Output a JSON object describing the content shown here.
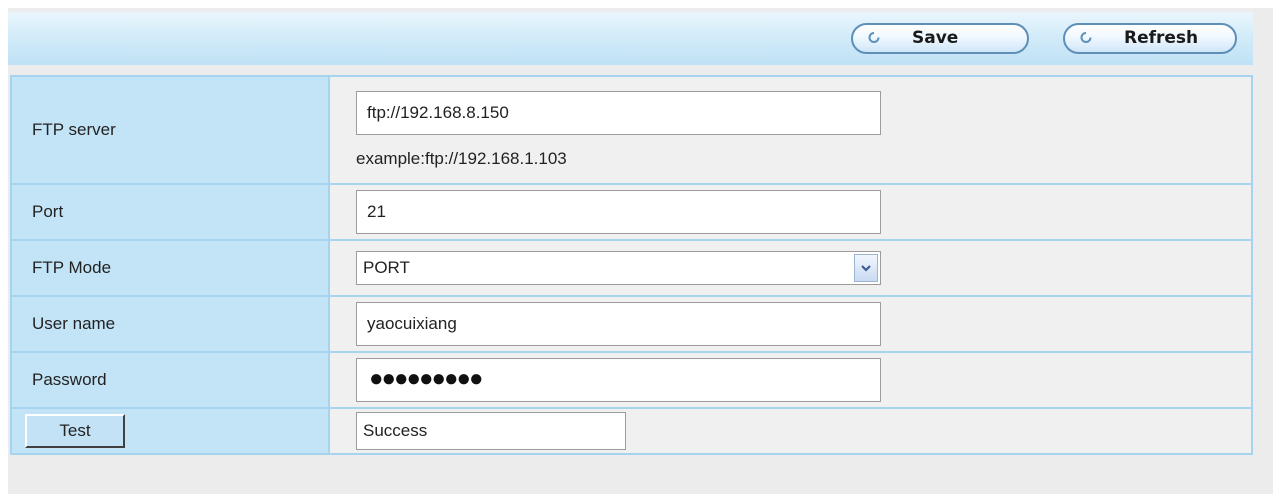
{
  "toolbar": {
    "save_label": "Save",
    "refresh_label": "Refresh"
  },
  "form": {
    "ftp_server": {
      "label": "FTP server",
      "value": "ftp://192.168.8.150",
      "hint": "example:ftp://192.168.1.103"
    },
    "port": {
      "label": "Port",
      "value": "21"
    },
    "ftp_mode": {
      "label": "FTP Mode",
      "selected": "PORT"
    },
    "user_name": {
      "label": "User name",
      "value": "yaocuixiang"
    },
    "password": {
      "label": "Password",
      "masked": "●●●●●●●●●"
    },
    "test": {
      "button_label": "Test",
      "result": "Success"
    }
  },
  "icons": {
    "save": "refresh-icon",
    "refresh": "refresh-icon",
    "dropdown": "chevron-down-icon"
  },
  "colors": {
    "toolbar_bg": "#c9e6f7",
    "label_cell_bg": "#c3e4f7",
    "value_cell_bg": "#f0f0f0",
    "border": "#a6d3ee",
    "button_border": "#5e8fb7"
  }
}
